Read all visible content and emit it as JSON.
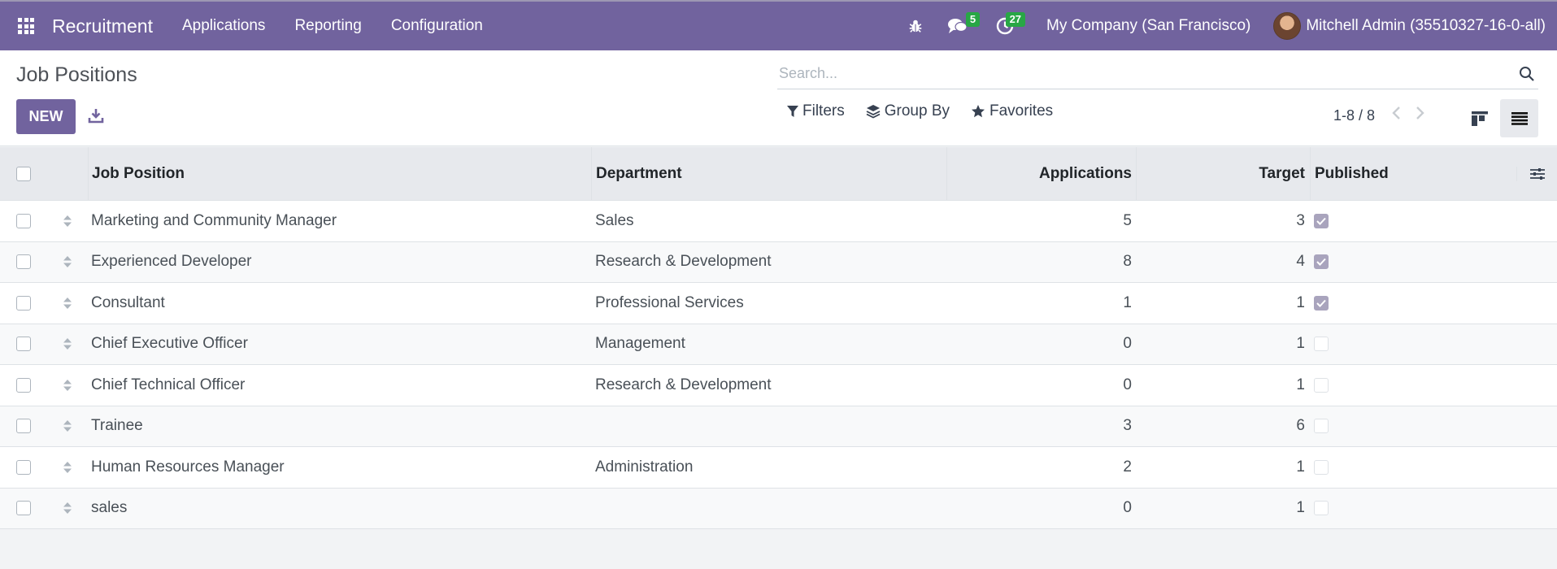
{
  "navbar": {
    "app_name": "Recruitment",
    "menu": [
      "Applications",
      "Reporting",
      "Configuration"
    ],
    "messages_count": "5",
    "activities_count": "27",
    "company": "My Company (San Francisco)",
    "user": "Mitchell Admin (35510327-16-0-all)"
  },
  "control": {
    "title": "Job Positions",
    "new_label": "NEW",
    "search_placeholder": "Search...",
    "filters_label": "Filters",
    "group_by_label": "Group By",
    "favorites_label": "Favorites",
    "pager": "1-8 / 8"
  },
  "table": {
    "headers": {
      "job": "Job Position",
      "dept": "Department",
      "apps": "Applications",
      "target": "Target",
      "published": "Published"
    },
    "rows": [
      {
        "job": "Marketing and Community Manager",
        "dept": "Sales",
        "apps": "5",
        "target": "3",
        "published": true
      },
      {
        "job": "Experienced Developer",
        "dept": "Research & Development",
        "apps": "8",
        "target": "4",
        "published": true
      },
      {
        "job": "Consultant",
        "dept": "Professional Services",
        "apps": "1",
        "target": "1",
        "published": true
      },
      {
        "job": "Chief Executive Officer",
        "dept": "Management",
        "apps": "0",
        "target": "1",
        "published": false
      },
      {
        "job": "Chief Technical Officer",
        "dept": "Research & Development",
        "apps": "0",
        "target": "1",
        "published": false
      },
      {
        "job": "Trainee",
        "dept": "",
        "apps": "3",
        "target": "6",
        "published": false
      },
      {
        "job": "Human Resources Manager",
        "dept": "Administration",
        "apps": "2",
        "target": "1",
        "published": false
      },
      {
        "job": "sales",
        "dept": "",
        "apps": "0",
        "target": "1",
        "published": false
      }
    ]
  },
  "colors": {
    "brand": "#71639e",
    "badge": "#28a745",
    "checked": "#a9a4bd"
  },
  "icons": [
    "apps-grid-icon",
    "bug-icon",
    "chat-icon",
    "clock-icon",
    "download-icon",
    "search-icon",
    "filter-icon",
    "layers-icon",
    "star-icon",
    "chevron-left-icon",
    "chevron-right-icon",
    "kanban-view-icon",
    "list-view-icon",
    "drag-handle-icon",
    "column-options-icon",
    "check-icon"
  ]
}
